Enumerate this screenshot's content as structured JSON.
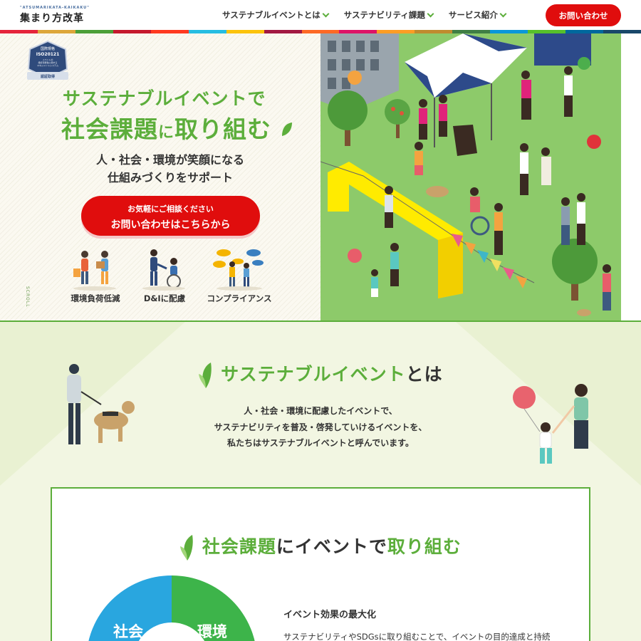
{
  "header": {
    "logo_sub": "\"ATSUMARIKATA-KAIKAKU\"",
    "logo_main": "集まり方改革",
    "nav": [
      {
        "label": "サステナブルイベントとは"
      },
      {
        "label": "サステナビリティ課題"
      },
      {
        "label": "サービス紹介"
      }
    ],
    "cta": "お問い合わせ"
  },
  "sdg_colors": [
    "#e5243b",
    "#dda63a",
    "#4c9f38",
    "#c5192d",
    "#ff3a21",
    "#26bde2",
    "#fcc30b",
    "#a21942",
    "#fd6925",
    "#dd1367",
    "#fd9d24",
    "#bf8b2e",
    "#3f7e44",
    "#0a97d9",
    "#56c02b",
    "#00689d",
    "#19486a"
  ],
  "hero": {
    "badge_lines": [
      "国際規格",
      "ISO20121",
      "イベントの",
      "持続可能性に関する",
      "マネジメントシステム",
      "認証取得"
    ],
    "title_line1": "サステナブルイベントで",
    "title_line2_a": "社会課題",
    "title_line2_b": "に",
    "title_line2_c": "取り組む",
    "subtitle_line1": "人・社会・環境が笑顔になる",
    "subtitle_line2": "仕組みづくりをサポート",
    "cta_line1": "お気軽にご相談ください",
    "cta_line2": "お問い合わせはこちらから",
    "features": [
      {
        "label": "環境負荷低減",
        "icon": "people-recycling-icon"
      },
      {
        "label": "D&Iに配慮",
        "icon": "wheelchair-handshake-icon"
      },
      {
        "label": "コンプライアンス",
        "icon": "speech-bubbles-icon"
      }
    ],
    "scroll": "SCROLL"
  },
  "about": {
    "title_a": "サステナブルイベント",
    "title_b": "とは",
    "body": [
      "人・社会・環境に配慮したイベントで、",
      "サステナビリティを普及・啓発していけるイベントを、",
      "私たちはサステナブルイベントと呼んでいます。"
    ]
  },
  "issues": {
    "title_a": "社会課題",
    "title_b": "に",
    "title_c": "イベントで",
    "title_d": "取り組む",
    "donut_labels": [
      "社会",
      "環境"
    ],
    "subhead": "イベント効果の最大化",
    "text": "サステナビリティやSDGsに取り組むことで、イベントの目的達成と持続"
  }
}
